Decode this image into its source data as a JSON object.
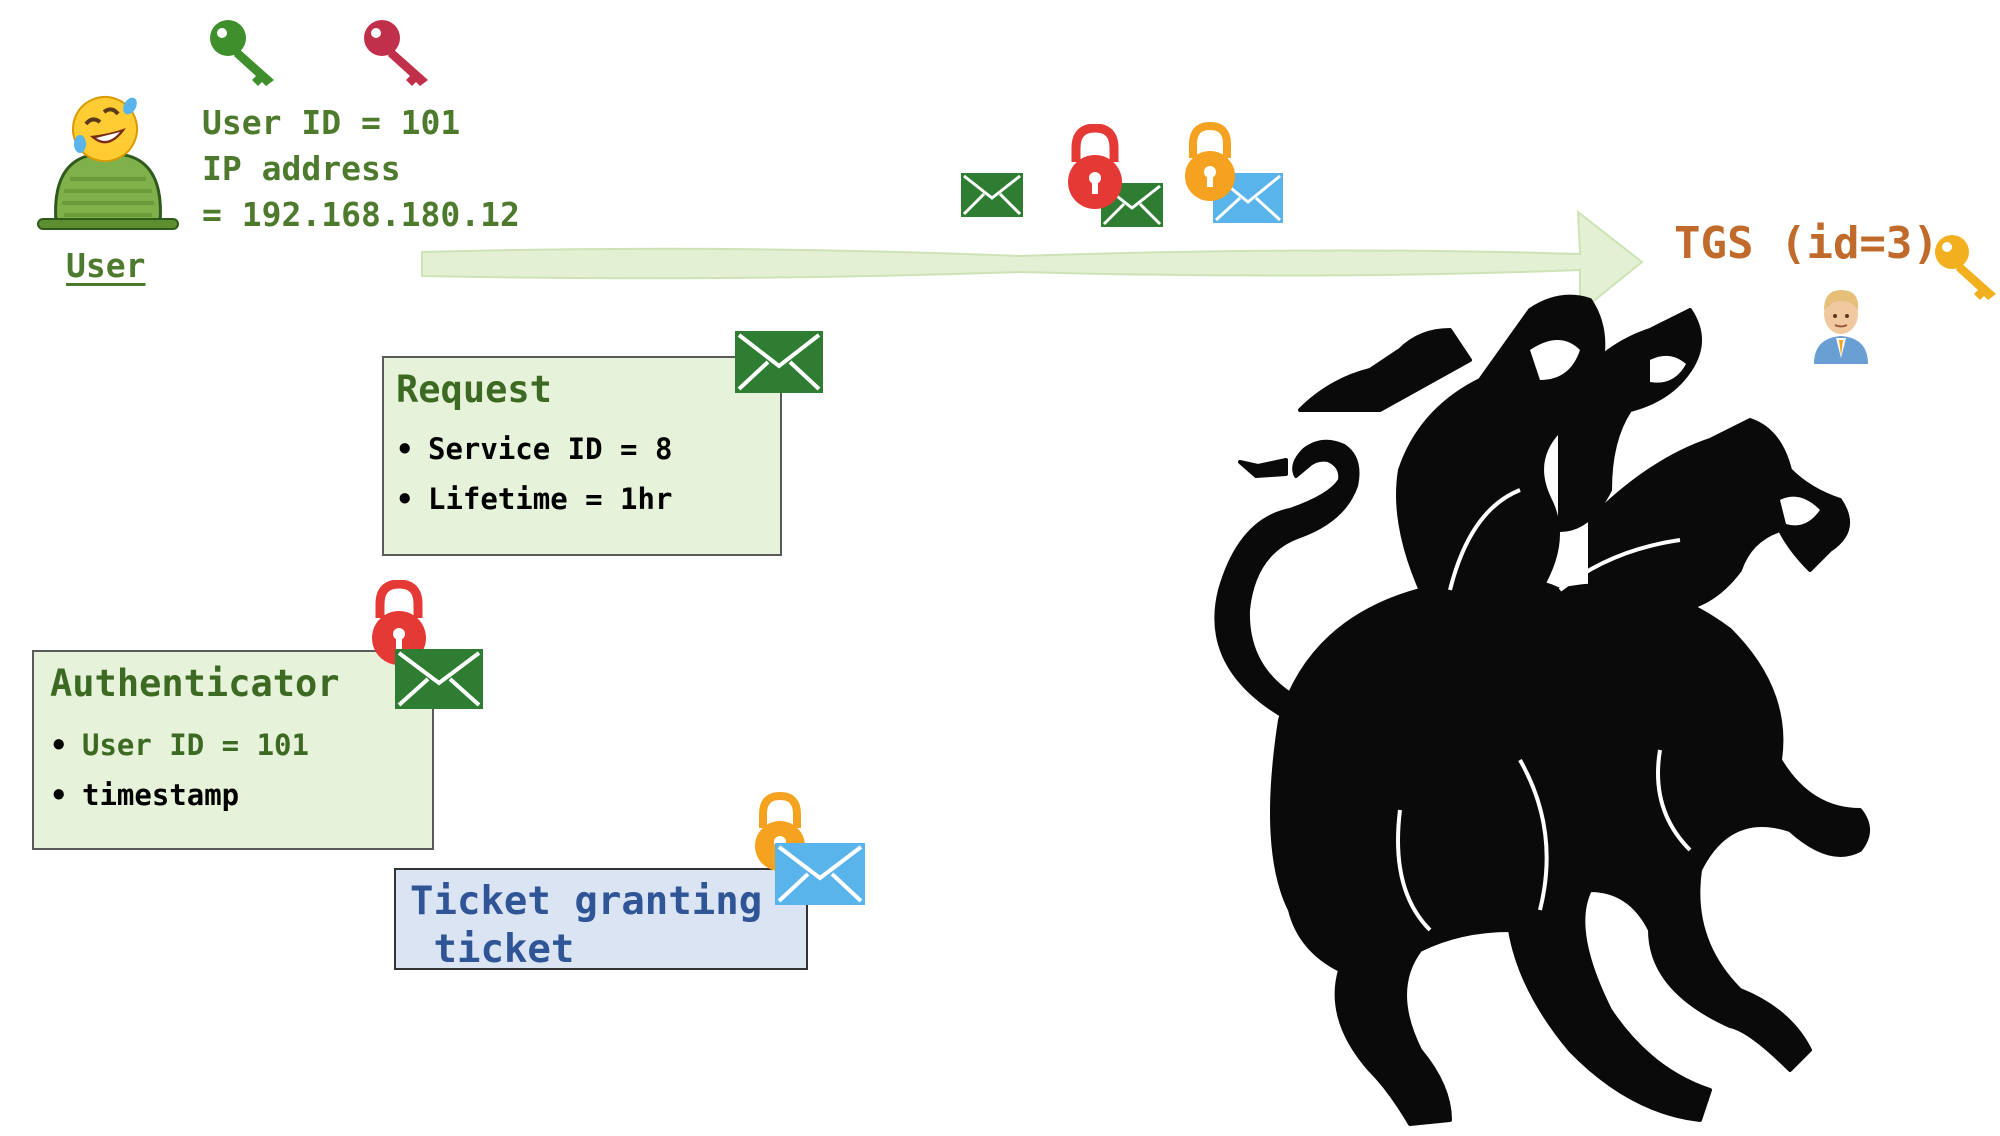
{
  "user": {
    "label": "User",
    "id_line": "User ID = 101",
    "ip_line1": "IP address",
    "ip_line2": "= 192.168.180.12",
    "icons": [
      "rolling-on-floor-laughing-face-icon",
      "green-person-icon",
      "green-key-icon",
      "red-key-icon"
    ]
  },
  "tgs": {
    "label": "TGS (id=3)",
    "icons": [
      "gold-key-icon",
      "man-office-worker-icon",
      "three-headed-dog-cerberus-image"
    ]
  },
  "arrow": {
    "icons": [
      "green-envelope-icon",
      "red-padlock-icon",
      "orange-padlock-icon",
      "blue-envelope-icon"
    ]
  },
  "request": {
    "title": "Request",
    "items": [
      "Service ID = 8",
      "Lifetime = 1hr"
    ]
  },
  "authenticator": {
    "title": "Authenticator",
    "items": [
      "User ID = 101",
      "timestamp"
    ]
  },
  "ticket": {
    "title_line1": "Ticket granting",
    "title_line2": " ticket"
  },
  "colors": {
    "green_text": "#4d7a2c",
    "box_green": "#e7f2da",
    "box_blue": "#dbe4f3",
    "envelope_green": "#2e7d32",
    "envelope_blue": "#5ab4ec",
    "lock_red": "#e53935",
    "lock_orange": "#f4a21f",
    "key_green": "#3f8f2c",
    "key_red": "#c0304a",
    "key_gold": "#f2b01e",
    "tgs_text": "#c06a2b",
    "ticket_text": "#2f5597"
  }
}
